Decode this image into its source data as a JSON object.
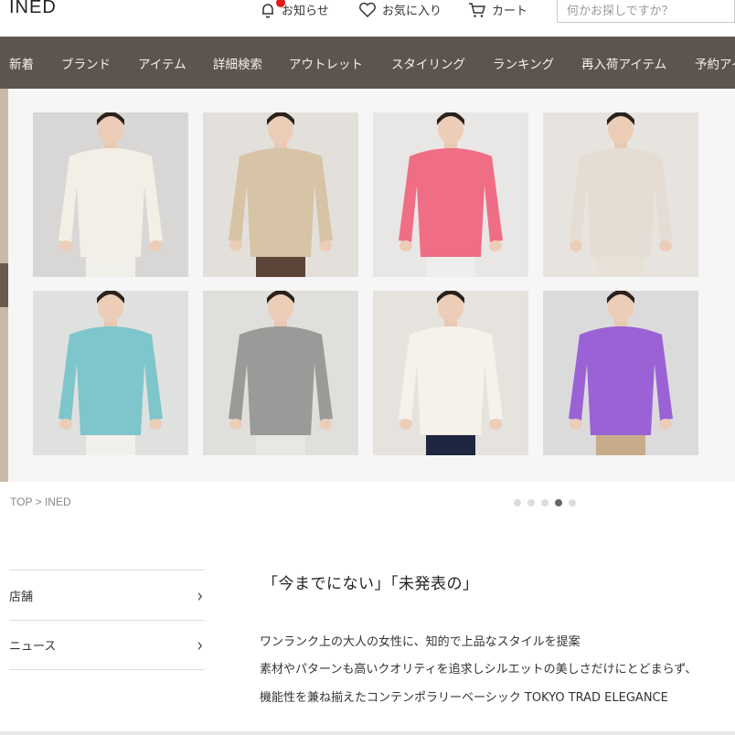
{
  "header": {
    "logo": "INED",
    "notifications": "お知らせ",
    "favorites": "お気に入り",
    "cart": "カート",
    "search_placeholder": "何かお探しですか？"
  },
  "nav": {
    "items": [
      "新着",
      "ブランド",
      "アイテム",
      "詳細検索",
      "アウトレット",
      "スタイリング",
      "ランキング",
      "再入荷アイテム",
      "予約アイ"
    ]
  },
  "hero": {
    "tiles": [
      {
        "name": "fair-isle-sweater",
        "bg": "#d9d7d6",
        "garment": "#f2efe7",
        "pants": "#f1efe9"
      },
      {
        "name": "beige-cardigan",
        "bg": "#e3e0dc",
        "garment": "#d7c3a6",
        "pants": "#5a4538"
      },
      {
        "name": "pink-sweater",
        "bg": "#e9e7e5",
        "garment": "#ef6e85",
        "pants": "#eeeeee"
      },
      {
        "name": "oatmeal-cardigan",
        "bg": "#e7e4e0",
        "garment": "#e5ddd3",
        "pants": "#e8e1d8"
      },
      {
        "name": "aqua-cable-sweater",
        "bg": "#dfe1df",
        "garment": "#7fc5cc",
        "pants": "#f2f0ea"
      },
      {
        "name": "grey-rib-sweater",
        "bg": "#e1dfdc",
        "garment": "#9a9a98",
        "pants": "#e9e7e2"
      },
      {
        "name": "striped-sweater",
        "bg": "#e6e3df",
        "garment": "#f5f2ea",
        "pants": "#1f2740"
      },
      {
        "name": "purple-sweater",
        "bg": "#dcdbdc",
        "garment": "#9b62d6",
        "pants": "#c8ab8a"
      }
    ]
  },
  "breadcrumb": {
    "top": "TOP",
    "separator": ">",
    "current": "INED"
  },
  "carousel": {
    "dot_count": 5,
    "active_dot": 4
  },
  "side_menu": {
    "items": [
      "店舗",
      "ニュース"
    ]
  },
  "intro": {
    "title": "「今までにない」「未発表の」",
    "line1": "ワンランク上の大人の女性に、知的で上品なスタイルを提案",
    "line2": "素材やパターンも高いクオリティを追求しシルエットの美しさだけにとどまらず、",
    "line3": "機能性を兼ね揃えたコンテンポラリーベーシック TOKYO TRAD ELEGANCE"
  },
  "colors": {
    "nav_bg": "#5d5450",
    "notification_dot": "#e21b1b"
  }
}
